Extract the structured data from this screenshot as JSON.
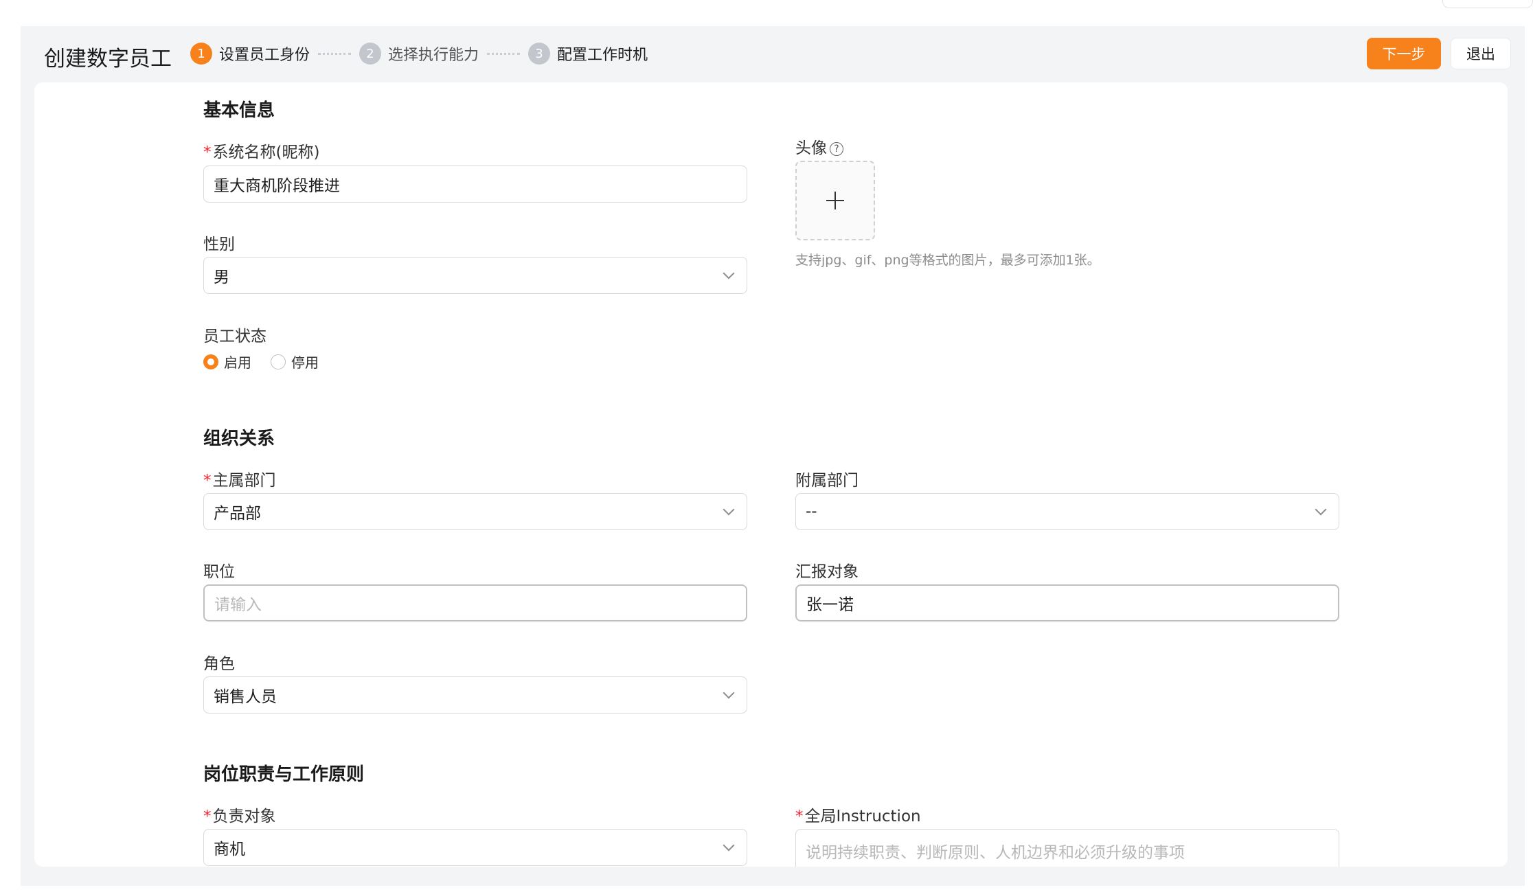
{
  "header": {
    "title": "创建数字员工",
    "steps": [
      {
        "num": "1",
        "label": "设置员工身份",
        "state": "active"
      },
      {
        "num": "2",
        "label": "选择执行能力",
        "state": "todo"
      },
      {
        "num": "3",
        "label": "配置工作时机",
        "state": "todo"
      }
    ],
    "next_label": "下一步",
    "exit_label": "退出"
  },
  "basic": {
    "section_title": "基本信息",
    "name_label": "系统名称(昵称)",
    "name_value": "重大商机阶段推进",
    "gender_label": "性别",
    "gender_value": "男",
    "status_label": "员工状态",
    "status_options": [
      "启用",
      "停用"
    ],
    "status_selected": "启用",
    "avatar_label": "头像",
    "avatar_help_icon": "question-circle-icon",
    "avatar_hint": "支持jpg、gif、png等格式的图片，最多可添加1张。"
  },
  "org": {
    "section_title": "组织关系",
    "main_dept_label": "主属部门",
    "main_dept_value": "产品部",
    "sub_dept_label": "附属部门",
    "sub_dept_value": "--",
    "position_label": "职位",
    "position_placeholder": "请输入",
    "report_label": "汇报对象",
    "report_value": "张一诺",
    "role_label": "角色",
    "role_value": "销售人员"
  },
  "duty": {
    "section_title": "岗位职责与工作原则",
    "target_label": "负责对象",
    "target_value": "商机",
    "instruction_label": "全局Instruction",
    "instruction_placeholder": "说明持续职责、判断原则、人机边界和必须升级的事项"
  },
  "colors": {
    "accent": "#f7821b",
    "required": "#f5222d",
    "page_bg": "#f3f4f6"
  }
}
